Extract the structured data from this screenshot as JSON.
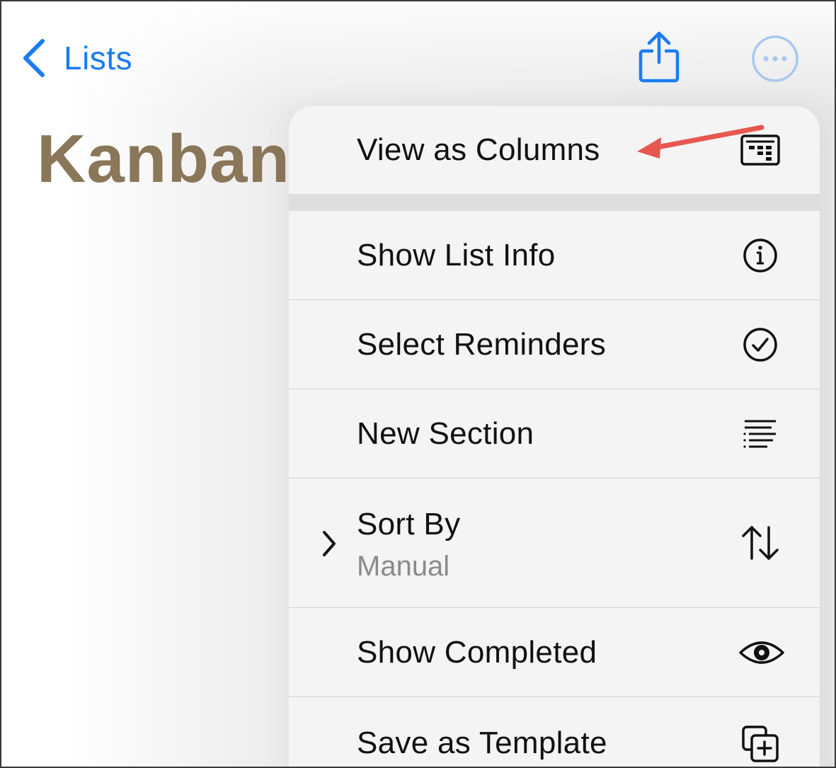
{
  "nav": {
    "back_label": "Lists"
  },
  "list": {
    "title": "Kanban"
  },
  "menu": {
    "items": [
      {
        "label": "View as Columns",
        "icon": "columns-icon"
      },
      {
        "label": "Show List Info",
        "icon": "info-circle-icon"
      },
      {
        "label": "Select Reminders",
        "icon": "checkmark-circle-icon"
      },
      {
        "label": "New Section",
        "icon": "section-lines-icon"
      },
      {
        "label": "Sort By",
        "sublabel": "Manual",
        "icon": "sort-arrows-icon"
      },
      {
        "label": "Show Completed",
        "icon": "eye-icon"
      },
      {
        "label": "Save as Template",
        "icon": "template-add-icon"
      }
    ]
  },
  "colors": {
    "accent": "#1a7cf2",
    "title": "#8a7658",
    "annotation_arrow": "#e8574f"
  }
}
